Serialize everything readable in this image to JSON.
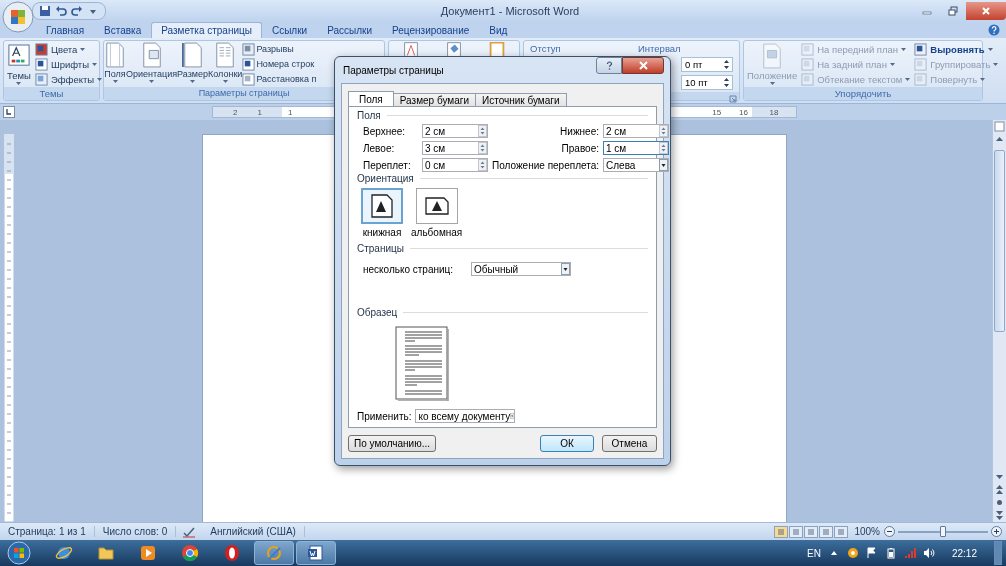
{
  "window": {
    "title": "Документ1 - Microsoft Word"
  },
  "ribbon_tabs": [
    {
      "label": "Главная",
      "selected": false
    },
    {
      "label": "Вставка",
      "selected": false
    },
    {
      "label": "Разметка страницы",
      "selected": true
    },
    {
      "label": "Ссылки",
      "selected": false
    },
    {
      "label": "Рассылки",
      "selected": false
    },
    {
      "label": "Рецензирование",
      "selected": false
    },
    {
      "label": "Вид",
      "selected": false
    }
  ],
  "themes_group": {
    "label": "Темы",
    "big_button": "Темы",
    "items": [
      "Цвета",
      "Шрифты",
      "Эффекты"
    ]
  },
  "page_setup_group": {
    "label": "Параметры страницы",
    "big_buttons": [
      "Поля",
      "Ориентация",
      "Размер",
      "Колонки"
    ],
    "items": [
      "Разрывы",
      "Номера строк",
      "Расстановка п"
    ]
  },
  "paragraph_group": {
    "indent_label": "Отступ",
    "spacing_label": "Интервал",
    "spacing_fields": [
      "0 пт",
      "10 пт"
    ]
  },
  "arrange_group": {
    "label": "Упорядочить",
    "big_button": {
      "label": "Положение",
      "disabled": true
    },
    "items": [
      {
        "label": "На передний план",
        "disabled": true
      },
      {
        "label": "На задний план",
        "disabled": true
      },
      {
        "label": "Обтекание текстом",
        "disabled": true
      },
      {
        "label": "Выровнять",
        "disabled": false
      },
      {
        "label": "Группировать",
        "disabled": true
      },
      {
        "label": "Повернуть",
        "disabled": true
      }
    ]
  },
  "ruler": {
    "left_marks": [
      "2",
      "1",
      "1"
    ],
    "right_marks": [
      "15",
      "16",
      "18"
    ]
  },
  "dialog": {
    "title": "Параметры страницы",
    "tabs": [
      {
        "label": "Поля",
        "selected": true
      },
      {
        "label": "Размер бумаги",
        "selected": false
      },
      {
        "label": "Источник бумаги",
        "selected": false
      }
    ],
    "margins_heading": "Поля",
    "margins": [
      {
        "label": "Верхнее:",
        "value": "2 см"
      },
      {
        "label": "Нижнее:",
        "value": "2 см"
      },
      {
        "label": "Левое:",
        "value": "3 см"
      },
      {
        "label": "Правое:",
        "value": "1 см"
      }
    ],
    "gutter": {
      "label": "Переплет:",
      "value": "0 см"
    },
    "gutter_position": {
      "label": "Положение переплета:",
      "value": "Слева"
    },
    "orientation_heading": "Ориентация",
    "orientations": [
      {
        "label": "книжная",
        "kind": "portrait",
        "selected": true
      },
      {
        "label": "альбомная",
        "kind": "landscape",
        "selected": false
      }
    ],
    "pages_heading": "Страницы",
    "multiple_pages": {
      "label": "несколько страниц:",
      "value": "Обычный"
    },
    "preview_heading": "Образец",
    "apply": {
      "label": "Применить:",
      "value": "ко всему документу"
    },
    "buttons": [
      {
        "label": "По умолчанию...",
        "kind": "default"
      },
      {
        "label": "ОК",
        "kind": "ok"
      },
      {
        "label": "Отмена",
        "kind": "cancel"
      }
    ]
  },
  "status_bar": {
    "page": "Страница: 1 из 1",
    "words": "Число слов: 0",
    "language": "Английский (США)",
    "zoom": "100%",
    "zoom_slider": {
      "level": 0.5
    }
  },
  "taskbar": {
    "apps": [
      {
        "kind": "browser",
        "running": false
      },
      {
        "kind": "folder",
        "running": false
      },
      {
        "kind": "player",
        "running": false
      },
      {
        "kind": "tricolor",
        "running": false
      },
      {
        "kind": "ring",
        "running": false
      },
      {
        "kind": "writer",
        "running": true
      },
      {
        "kind": "word",
        "running": true
      }
    ],
    "language": "EN",
    "clock": "22:12"
  }
}
